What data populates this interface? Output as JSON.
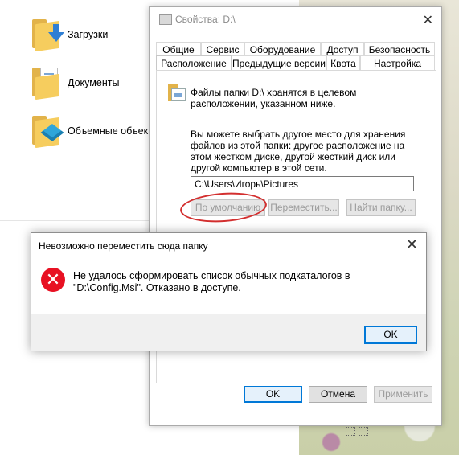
{
  "explorer": {
    "items": [
      {
        "label": "Загрузки",
        "icon": "downloads-folder-icon"
      },
      {
        "label": "Документы",
        "icon": "documents-folder-icon"
      },
      {
        "label": "Объемные объекты",
        "icon": "3d-objects-folder-icon"
      }
    ]
  },
  "properties": {
    "title": "Свойства: D:\\",
    "tabs_row1": [
      "Общие",
      "Сервис",
      "Оборудование",
      "Доступ",
      "Безопасность"
    ],
    "tabs_row2": [
      "Расположение",
      "Предыдущие версии",
      "Квота",
      "Настройка"
    ],
    "active_tab": "Расположение",
    "location_text": "Файлы папки D:\\ хранятся в целевом расположении, указанном ниже.",
    "info_text": "Вы можете выбрать другое место для хранения файлов из этой папки: другое расположение на этом жестком диске, другой жесткий диск или другой компьютер в этой сети.",
    "path_value": "C:\\Users\\Игорь\\Pictures",
    "buttons": {
      "default": "По умолчанию",
      "move": "Переместить...",
      "find": "Найти папку..."
    },
    "footer": {
      "ok": "OK",
      "cancel": "Отмена",
      "apply": "Применить"
    }
  },
  "error_dialog": {
    "title": "Невозможно переместить сюда папку",
    "message": "Не удалось сформировать список обычных подкаталогов в \"D:\\Config.Msi\". Отказано в доступе.",
    "ok_label": "OK",
    "icon": "error-icon"
  },
  "colors": {
    "accent": "#0078d7",
    "error": "#e81123",
    "annotation": "#d32f2f"
  }
}
